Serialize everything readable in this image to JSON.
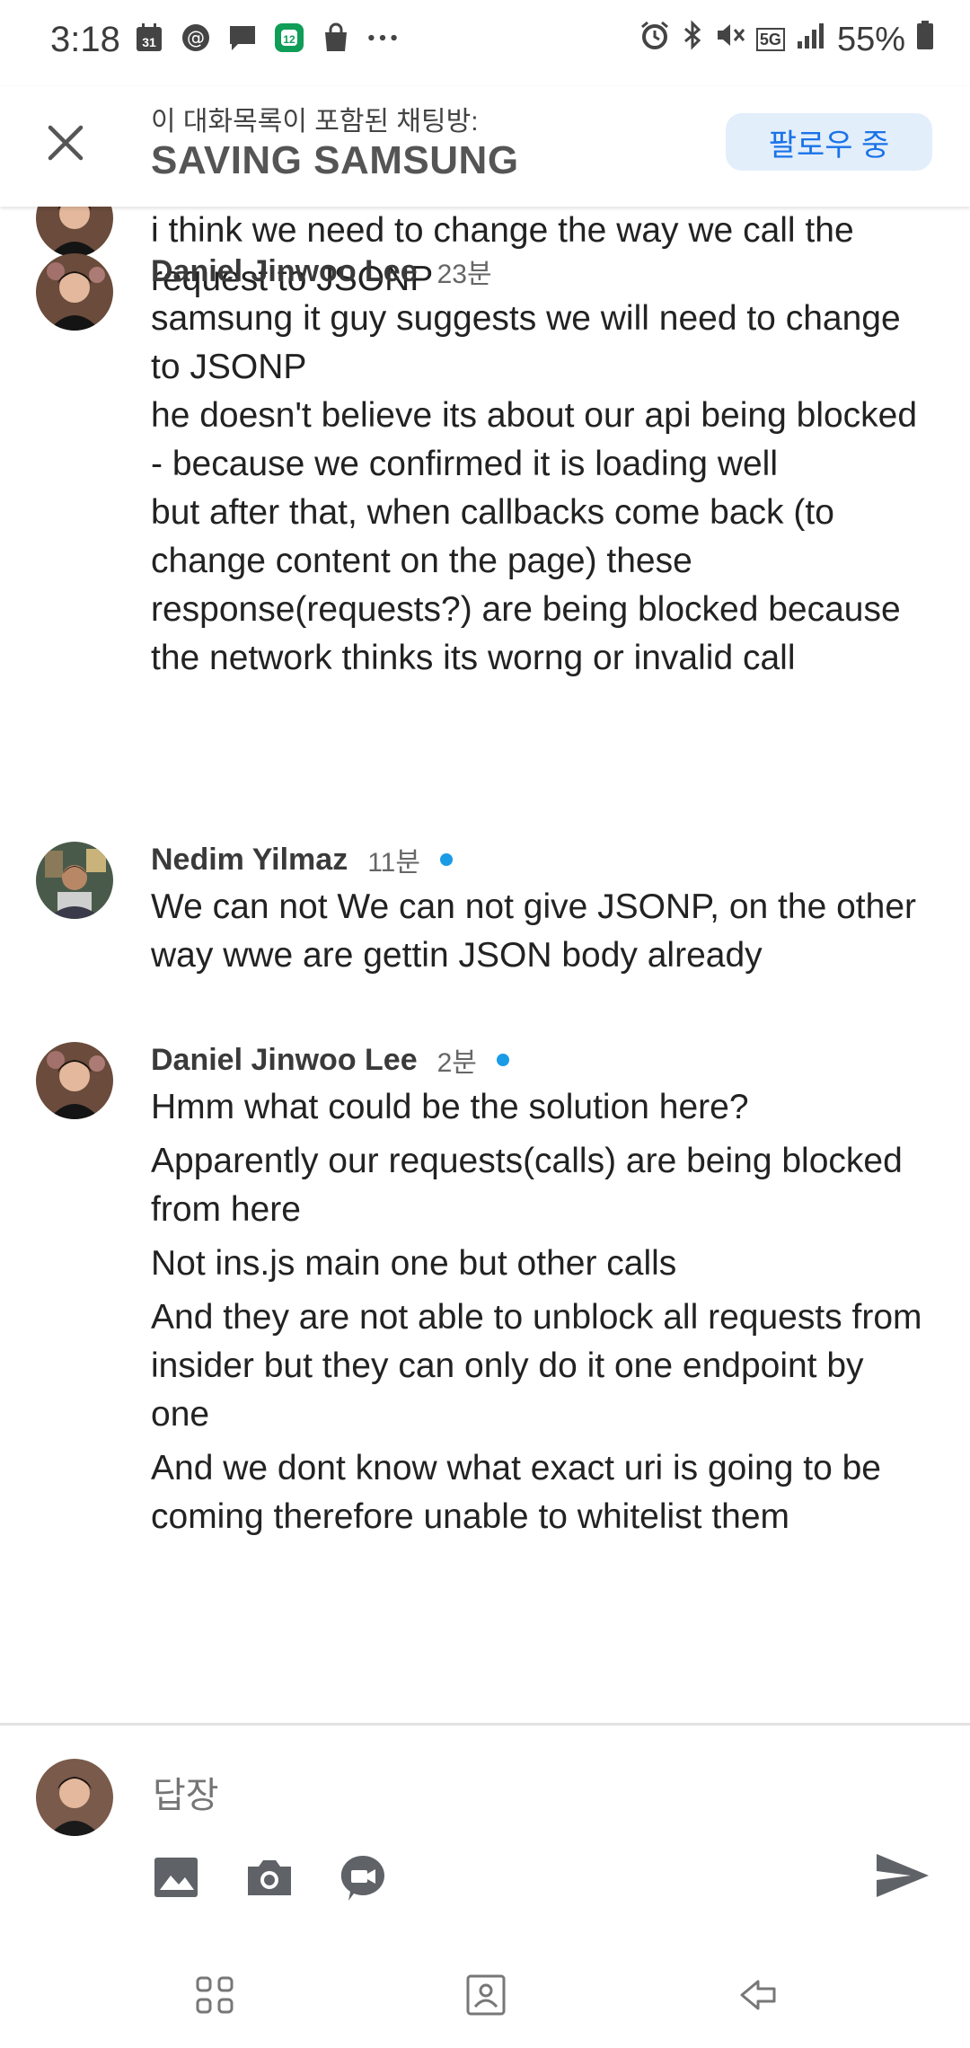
{
  "status": {
    "time": "3:18",
    "battery": "55%",
    "network": "5G"
  },
  "header": {
    "subtitle": "이 대화목록이 포함된 채팅방:",
    "title": "SAVING SAMSUNG",
    "follow_label": "팔로우 중"
  },
  "messages": [
    {
      "author": "",
      "time": "",
      "paragraphs": [
        "i think we need to change the way we call the request to JSONP"
      ]
    },
    {
      "author": "Daniel Jinwoo Lee",
      "time": "23분",
      "paragraphs": [
        "samsung it guy suggests we will need to change to JSONP",
        "he doesn't believe its about our api being blocked - because we confirmed it is loading well",
        "but after that, when callbacks come back (to change content on the page) these response(requests?) are being blocked because the network thinks its worng or invalid call"
      ]
    },
    {
      "author": "Nedim Yilmaz",
      "time": "11분",
      "paragraphs": [
        "We can not We can not give JSONP, on the other way wwe are gettin JSON body already"
      ]
    },
    {
      "author": "Daniel Jinwoo Lee",
      "time": "2분",
      "paragraphs": [
        "Hmm what could be the solution here?",
        "Apparently our requests(calls) are being blocked from here",
        "Not ins.js main one but other calls",
        "And they are not able to unblock all requests from insider but they can only do it one endpoint by one",
        "And we dont know what exact uri is going to be coming therefore unable to whitelist them"
      ]
    }
  ],
  "composer": {
    "placeholder": "답장"
  },
  "colors": {
    "accent": "#1a73e8",
    "follow_bg": "#e3eefb",
    "unread_dot": "#1a9be6"
  }
}
